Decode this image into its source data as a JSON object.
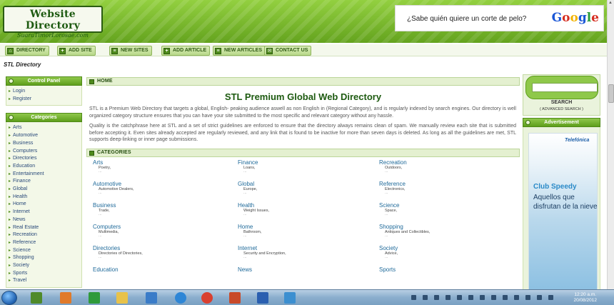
{
  "header": {
    "logo_title": "Website Directory",
    "logo_subtitle": "SuaraTimorLorosae.com",
    "ad_text": "¿Sabe quién quiere un corte de pelo?",
    "ad_brand": "Google"
  },
  "nav": {
    "items": [
      {
        "label": "DIRECTORY"
      },
      {
        "label": "ADD SITE"
      },
      {
        "label": "NEW SITES"
      },
      {
        "label": "ADD ARTICLE"
      },
      {
        "label": "NEW ARTICLES"
      },
      {
        "label": "CONTACT US"
      }
    ]
  },
  "breadcrumb": "STL Directory",
  "left": {
    "control_panel_title": "Control Panel",
    "control_links": [
      "Login",
      "Register"
    ],
    "categories_title": "Categories",
    "categories": [
      "Arts",
      "Automotive",
      "Business",
      "Computers",
      "Directories",
      "Education",
      "Entertainment",
      "Finance",
      "Global",
      "Health",
      "Home",
      "Internet",
      "News",
      "Real Estate",
      "Recreation",
      "Reference",
      "Science",
      "Shopping",
      "Society",
      "Sports",
      "Travel"
    ]
  },
  "main": {
    "home_header": "HOME",
    "title": "STL Premium Global Web Directory",
    "para1": "STL is a Premium Web Directory that targets a global, English- peaking audience aswell as non English in (Regional Category), and is regularly indexed by search engines. Our directory is well organized category structure ensures that you can have your site submitted to the most specific and relevant category without any hassle.",
    "para2": "Quality is the catchphrase here at STL and a set of strict guidelines are enforced to ensure that the directory always remains clean of spam. We manually review each site that is submitted before accepting it. Even sites already accepted are regularly reviewed, and any link that is found to be inactive for more than seven days is deleted. As long as all the guidelines are met, STL supports deep-linking or inner page submissions.",
    "categories_header": "CATEGORIES",
    "category_grid": [
      {
        "name": "Arts",
        "sub": "Poetry,"
      },
      {
        "name": "Finance",
        "sub": "Loans,"
      },
      {
        "name": "Recreation",
        "sub": "Outdoors,"
      },
      {
        "name": "Automotive",
        "sub": "Automotive Dealers,"
      },
      {
        "name": "Global",
        "sub": "Europe,"
      },
      {
        "name": "Reference",
        "sub": "Electronics,"
      },
      {
        "name": "Business",
        "sub": "Trade,"
      },
      {
        "name": "Health",
        "sub": "Weight Issues,"
      },
      {
        "name": "Science",
        "sub": "Space,"
      },
      {
        "name": "Computers",
        "sub": "Multimedia,"
      },
      {
        "name": "Home",
        "sub": "Bathroom,"
      },
      {
        "name": "Shopping",
        "sub": "Antiques and Collectibles,"
      },
      {
        "name": "Directories",
        "sub": "Directories of Directories,"
      },
      {
        "name": "Internet",
        "sub": "Security and Encryption,"
      },
      {
        "name": "Society",
        "sub": "Advice,"
      },
      {
        "name": "Education",
        "sub": ""
      },
      {
        "name": "News",
        "sub": ""
      },
      {
        "name": "Sports",
        "sub": ""
      }
    ],
    "ellipsis": "..."
  },
  "right": {
    "search_value": "",
    "search_label": "SEARCH",
    "advanced_search": "( ADVANCED SEARCH )",
    "advertisement_title": "Advertisement",
    "ad_brand": "Telefónica",
    "ad_heading": "Club Speedy",
    "ad_text": "Aquellos que disfrutan de la nieve"
  },
  "taskbar": {
    "time": "12:20 a.m.",
    "date": "20/08/2012"
  }
}
